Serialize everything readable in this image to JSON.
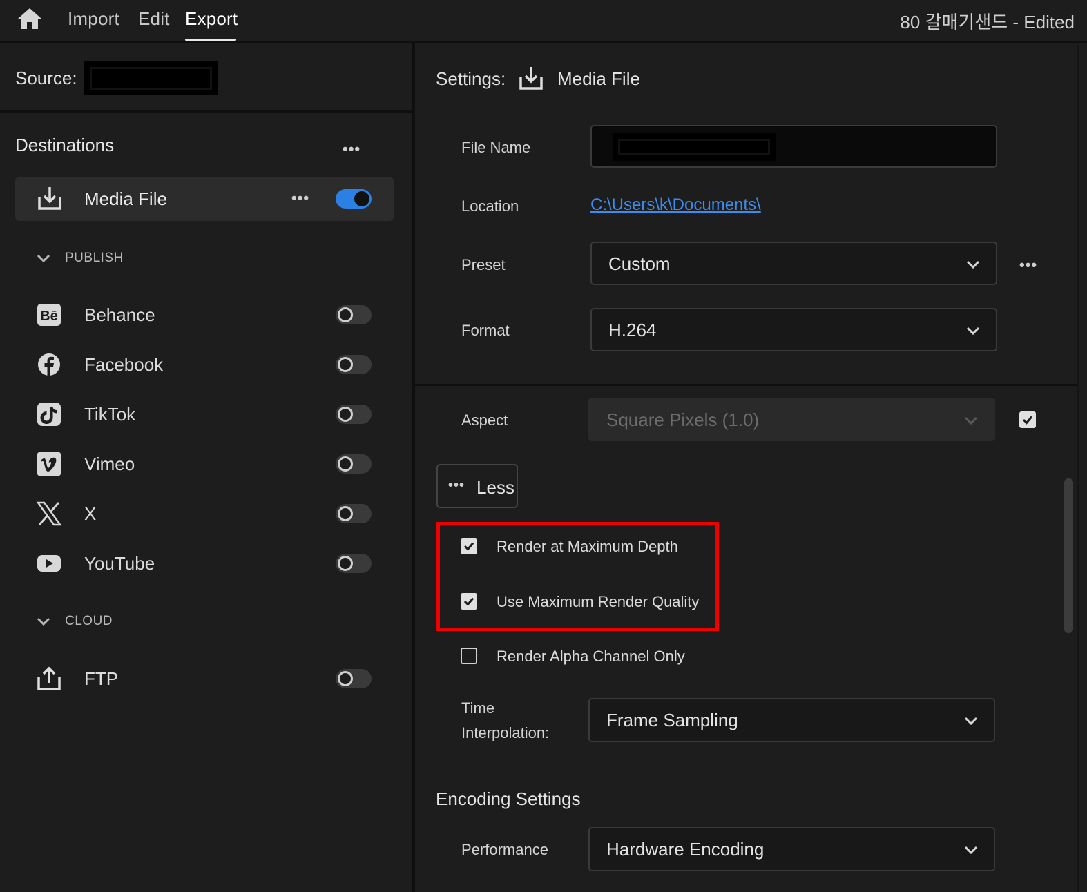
{
  "topbar": {
    "home_icon": "home-icon",
    "tabs": [
      {
        "label": "Import"
      },
      {
        "label": "Edit"
      },
      {
        "label": "Export"
      }
    ],
    "active_tab": "Export",
    "document_title": "80 갈매기샌드 - Edited"
  },
  "source": {
    "label": "Source:",
    "value": ""
  },
  "destinations": {
    "title": "Destinations",
    "more": "•••",
    "media_file": {
      "label": "Media File",
      "icon": "download-tray-icon",
      "more": "•••",
      "enabled": true
    },
    "sections": [
      {
        "heading": "PUBLISH",
        "items": [
          {
            "label": "Behance",
            "icon": "behance-icon",
            "enabled": false
          },
          {
            "label": "Facebook",
            "icon": "facebook-icon",
            "enabled": false
          },
          {
            "label": "TikTok",
            "icon": "tiktok-icon",
            "enabled": false
          },
          {
            "label": "Vimeo",
            "icon": "vimeo-icon",
            "enabled": false
          },
          {
            "label": "X",
            "icon": "x-icon",
            "enabled": false
          },
          {
            "label": "YouTube",
            "icon": "youtube-icon",
            "enabled": false
          }
        ]
      },
      {
        "heading": "CLOUD",
        "items": [
          {
            "label": "FTP",
            "icon": "upload-tray-icon",
            "enabled": false
          }
        ]
      }
    ]
  },
  "settings": {
    "heading": "Settings:",
    "target": "Media File",
    "file_name": {
      "label": "File Name",
      "value": ""
    },
    "location": {
      "label": "Location",
      "value": "C:\\Users\\k\\Documents\\"
    },
    "preset": {
      "label": "Preset",
      "value": "Custom",
      "more": "•••"
    },
    "format": {
      "label": "Format",
      "value": "H.264"
    },
    "aspect": {
      "label": "Aspect",
      "value": "Square Pixels (1.0)",
      "checked": true
    },
    "less_button": "Less",
    "options": [
      {
        "label": "Render at Maximum Depth",
        "checked": true
      },
      {
        "label": "Use Maximum Render Quality",
        "checked": true
      },
      {
        "label": "Render Alpha Channel Only",
        "checked": false
      }
    ],
    "time_interpolation": {
      "label_line1": "Time",
      "label_line2": "Interpolation:",
      "value": "Frame Sampling"
    },
    "encoding": {
      "heading": "Encoding Settings",
      "performance": {
        "label": "Performance",
        "value": "Hardware Encoding"
      }
    }
  },
  "colors": {
    "accent": "#2d80e3",
    "highlight_box": "#ee0000",
    "link": "#3b8cf0"
  }
}
